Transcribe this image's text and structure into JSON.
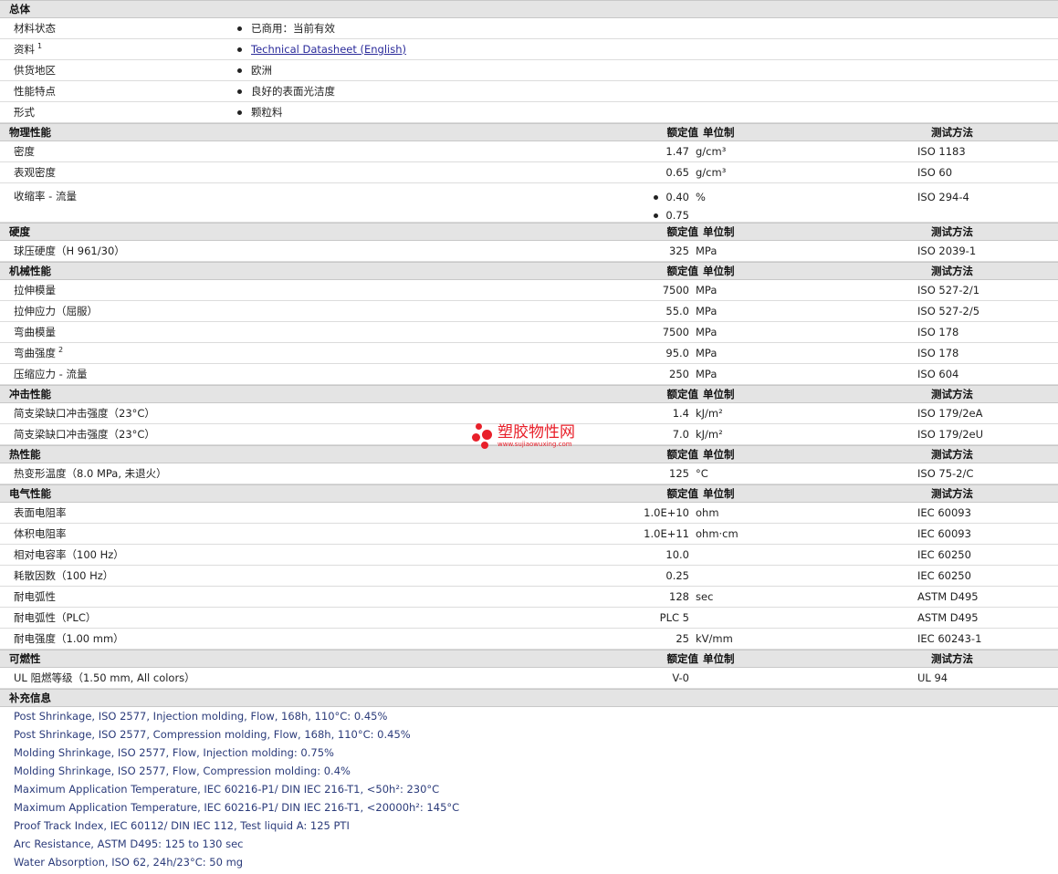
{
  "general": {
    "title": "总体",
    "rows": [
      {
        "label": "材料状态",
        "value": "已商用：当前有效"
      },
      {
        "label": "资料",
        "sup": "1",
        "value": "Technical Datasheet (English)",
        "link": true
      },
      {
        "label": "供货地区",
        "value": "欧洲"
      },
      {
        "label": "性能特点",
        "value": "良好的表面光洁度"
      },
      {
        "label": "形式",
        "value": "颗粒料"
      }
    ]
  },
  "headers": {
    "value": "额定值",
    "unit": "单位制",
    "test": "测试方法"
  },
  "sections": [
    {
      "title": "物理性能",
      "rows": [
        {
          "label": "密度",
          "value": "1.47",
          "unit": "g/cm³",
          "test": "ISO 1183"
        },
        {
          "label": "表观密度",
          "value": "0.65",
          "unit": "g/cm³",
          "test": "ISO 60"
        },
        {
          "label": "收缩率  - 流量",
          "values": [
            "0.40",
            "0.75"
          ],
          "unit": "%",
          "test": "ISO 294-4"
        }
      ]
    },
    {
      "title": "硬度",
      "rows": [
        {
          "label": "球压硬度（H 961/30）",
          "value": "325",
          "unit": "MPa",
          "test": "ISO 2039-1"
        }
      ]
    },
    {
      "title": "机械性能",
      "rows": [
        {
          "label": "拉伸模量",
          "value": "7500",
          "unit": "MPa",
          "test": "ISO 527-2/1"
        },
        {
          "label": "拉伸应力（屈服）",
          "value": "55.0",
          "unit": "MPa",
          "test": "ISO 527-2/5"
        },
        {
          "label": "弯曲模量",
          "value": "7500",
          "unit": "MPa",
          "test": "ISO 178"
        },
        {
          "label": "弯曲强度",
          "sup": "2",
          "value": "95.0",
          "unit": "MPa",
          "test": "ISO 178"
        },
        {
          "label": "压缩应力  - 流量",
          "value": "250",
          "unit": "MPa",
          "test": "ISO 604"
        }
      ]
    },
    {
      "title": "冲击性能",
      "rows": [
        {
          "label": "简支梁缺口冲击强度（23°C）",
          "value": "1.4",
          "unit": "kJ/m²",
          "test": "ISO 179/2eA"
        },
        {
          "label": "简支梁缺口冲击强度（23°C）",
          "value": "7.0",
          "unit": "kJ/m²",
          "test": "ISO 179/2eU"
        }
      ]
    },
    {
      "title": "热性能",
      "rows": [
        {
          "label": "热变形温度（8.0 MPa, 未退火）",
          "value": "125",
          "unit": "°C",
          "test": "ISO 75-2/C"
        }
      ]
    },
    {
      "title": "电气性能",
      "rows": [
        {
          "label": "表面电阻率",
          "value": "1.0E+10",
          "unit": "ohm",
          "test": "IEC 60093"
        },
        {
          "label": "体积电阻率",
          "value": "1.0E+11",
          "unit": "ohm·cm",
          "test": "IEC 60093"
        },
        {
          "label": "相对电容率（100 Hz）",
          "value": "10.0",
          "unit": "",
          "test": "IEC 60250"
        },
        {
          "label": "耗散因数（100 Hz）",
          "value": "0.25",
          "unit": "",
          "test": "IEC 60250"
        },
        {
          "label": "耐电弧性",
          "value": "128",
          "unit": "sec",
          "test": "ASTM D495"
        },
        {
          "label": "耐电弧性（PLC）",
          "value": "PLC 5",
          "unit": "",
          "test": "ASTM D495"
        },
        {
          "label": "耐电强度（1.00 mm）",
          "value": "25",
          "unit": "kV/mm",
          "test": "IEC 60243-1"
        }
      ]
    },
    {
      "title": "可燃性",
      "rows": [
        {
          "label": "UL 阻燃等级（1.50 mm, All colors）",
          "value": "V-0",
          "unit": "",
          "test": "UL 94"
        }
      ]
    }
  ],
  "supplementary": {
    "title": "补充信息",
    "notes": [
      "Post Shrinkage, ISO 2577, Injection molding, Flow, 168h, 110°C: 0.45%",
      "Post Shrinkage, ISO 2577, Compression molding, Flow, 168h, 110°C: 0.45%",
      "Molding Shrinkage, ISO 2577, Flow, Injection molding: 0.75%",
      "Molding Shrinkage, ISO 2577, Flow, Compression molding: 0.4%",
      "Maximum Application Temperature, IEC 60216-P1/ DIN IEC 216-T1, <50h²: 230°C",
      "Maximum Application Temperature, IEC 60216-P1/ DIN IEC 216-T1, <20000h²: 145°C",
      "Proof Track Index, IEC 60112/ DIN IEC 112, Test liquid A: 125 PTI",
      "Arc Resistance, ASTM D495: 125 to 130 sec",
      "Water Absorption, ISO 62, 24h/23°C: 50 mg"
    ]
  },
  "watermark": {
    "name": "塑胶物性网",
    "url": "www.sujiaowuxing.com",
    "color": "#e8202a"
  }
}
